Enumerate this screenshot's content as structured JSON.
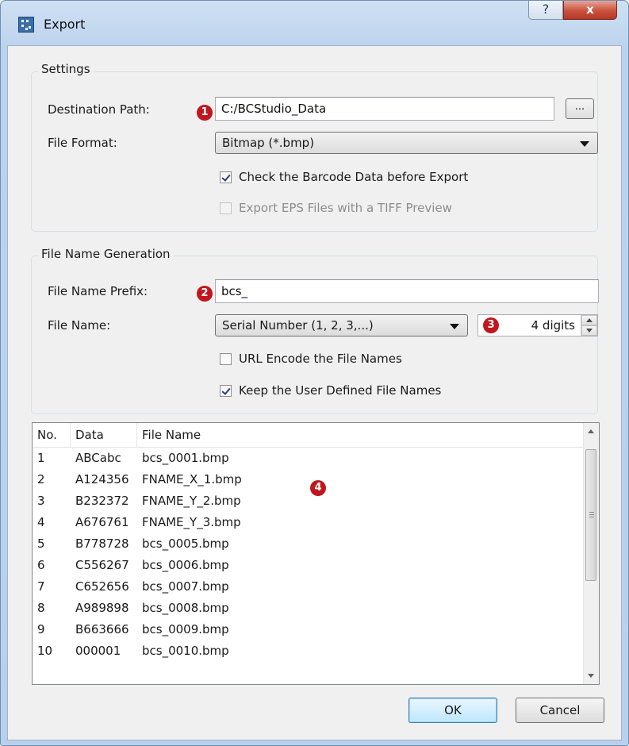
{
  "window": {
    "title": "Export",
    "help_label": "?",
    "close_label": "x"
  },
  "settings": {
    "group_title": "Settings",
    "destination_label": "Destination Path:",
    "destination_value": "C:/BCStudio_Data",
    "browse_label": "...",
    "file_format_label": "File Format:",
    "file_format_value": "Bitmap (*.bmp)",
    "check_barcode_label": "Check the Barcode Data before Export",
    "check_barcode_checked": true,
    "export_eps_label": "Export EPS Files with a TIFF Preview",
    "export_eps_checked": false,
    "export_eps_enabled": false
  },
  "file_name_generation": {
    "group_title": "File Name Generation",
    "prefix_label": "File Name Prefix:",
    "prefix_value": "bcs_",
    "file_name_label": "File Name:",
    "file_name_value": "Serial Number (1, 2, 3,...)",
    "digits_value": "4 digits",
    "url_encode_label": "URL Encode the File Names",
    "url_encode_checked": false,
    "keep_user_label": "Keep the User Defined File Names",
    "keep_user_checked": true
  },
  "markers": [
    "1",
    "2",
    "3",
    "4"
  ],
  "table": {
    "columns": [
      "No.",
      "Data",
      "File Name"
    ],
    "rows": [
      [
        "1",
        "ABCabc",
        "bcs_0001.bmp"
      ],
      [
        "2",
        "A124356",
        "FNAME_X_1.bmp"
      ],
      [
        "3",
        "B232372",
        "FNAME_Y_2.bmp"
      ],
      [
        "4",
        "A676761",
        "FNAME_Y_3.bmp"
      ],
      [
        "5",
        "B778728",
        "bcs_0005.bmp"
      ],
      [
        "6",
        "C556267",
        "bcs_0006.bmp"
      ],
      [
        "7",
        "C652656",
        "bcs_0007.bmp"
      ],
      [
        "8",
        "A989898",
        "bcs_0008.bmp"
      ],
      [
        "9",
        "B663666",
        "bcs_0009.bmp"
      ],
      [
        "10",
        "000001",
        "bcs_0010.bmp"
      ]
    ]
  },
  "buttons": {
    "ok_label": "OK",
    "cancel_label": "Cancel"
  },
  "colors": {
    "marker": "#c0171e",
    "default_button": "#3c7fb1",
    "title_bar": "#bcd3ee"
  }
}
